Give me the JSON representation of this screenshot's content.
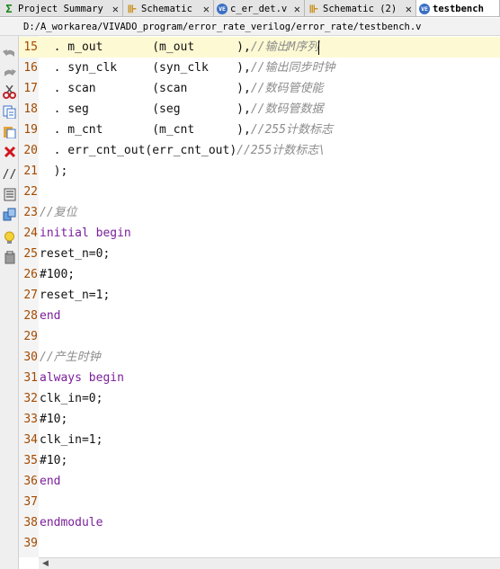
{
  "tabs": [
    {
      "label": "Project Summary",
      "icon": "sigma-icon",
      "active": false
    },
    {
      "label": "Schematic",
      "icon": "schematic-icon",
      "active": false
    },
    {
      "label": "c_er_det.v",
      "icon": "verilog-file-icon",
      "active": false
    },
    {
      "label": "Schematic (2)",
      "icon": "schematic-icon",
      "active": false
    },
    {
      "label": "testbench",
      "icon": "verilog-file-icon",
      "active": true
    }
  ],
  "tab_close_glyph": "✕",
  "file_path": "D:/A_workarea/VIVADO_program/error_rate_verilog/error_rate/testbench.v",
  "toolbar_icons": [
    "home-icon",
    "undo-icon",
    "redo-icon",
    "cut-icon",
    "copy-icon",
    "paste-icon",
    "delete-icon",
    "comment-icon",
    "grid-icon",
    "module-icon",
    "bulb-icon",
    "stamp-icon"
  ],
  "code_lines": [
    {
      "num": "15",
      "segs": [
        {
          "t": "  . m_out       (m_out      ),",
          "c": ""
        },
        {
          "t": "//输出M序列",
          "c": "cm"
        }
      ]
    },
    {
      "num": "16",
      "segs": [
        {
          "t": "  . syn_clk     (syn_clk    ),",
          "c": ""
        },
        {
          "t": "//输出同步时钟",
          "c": "cm"
        }
      ]
    },
    {
      "num": "17",
      "segs": [
        {
          "t": "  . scan        (scan       ),",
          "c": ""
        },
        {
          "t": "//数码管使能",
          "c": "cm"
        }
      ]
    },
    {
      "num": "18",
      "segs": [
        {
          "t": "  . seg         (seg        ),",
          "c": ""
        },
        {
          "t": "//数码管数据",
          "c": "cm"
        }
      ]
    },
    {
      "num": "19",
      "segs": [
        {
          "t": "  . m_cnt       (m_cnt      ),",
          "c": ""
        },
        {
          "t": "//255计数标志",
          "c": "cm"
        }
      ]
    },
    {
      "num": "20",
      "segs": [
        {
          "t": "  . err_cnt_out(err_cnt_out)",
          "c": ""
        },
        {
          "t": "//255计数标志\\",
          "c": "cm"
        }
      ]
    },
    {
      "num": "21",
      "segs": [
        {
          "t": "  );",
          "c": ""
        }
      ]
    },
    {
      "num": "22",
      "segs": []
    },
    {
      "num": "23",
      "segs": [
        {
          "t": "//复位",
          "c": "cm"
        }
      ]
    },
    {
      "num": "24",
      "segs": [
        {
          "t": "initial begin",
          "c": "kw"
        }
      ]
    },
    {
      "num": "25",
      "segs": [
        {
          "t": "reset_n=0;",
          "c": ""
        }
      ]
    },
    {
      "num": "26",
      "segs": [
        {
          "t": "#100;",
          "c": ""
        }
      ]
    },
    {
      "num": "27",
      "segs": [
        {
          "t": "reset_n=1;",
          "c": ""
        }
      ]
    },
    {
      "num": "28",
      "segs": [
        {
          "t": "end",
          "c": "kw"
        }
      ]
    },
    {
      "num": "29",
      "segs": []
    },
    {
      "num": "30",
      "segs": [
        {
          "t": "//产生时钟",
          "c": "cm"
        }
      ]
    },
    {
      "num": "31",
      "segs": [
        {
          "t": "always begin",
          "c": "kw"
        }
      ]
    },
    {
      "num": "32",
      "segs": [
        {
          "t": "clk_in=0;",
          "c": ""
        }
      ]
    },
    {
      "num": "33",
      "segs": [
        {
          "t": "#10;",
          "c": ""
        }
      ]
    },
    {
      "num": "34",
      "segs": [
        {
          "t": "clk_in=1;",
          "c": ""
        }
      ]
    },
    {
      "num": "35",
      "segs": [
        {
          "t": "#10;",
          "c": ""
        }
      ]
    },
    {
      "num": "36",
      "segs": [
        {
          "t": "end",
          "c": "kw"
        }
      ]
    },
    {
      "num": "37",
      "segs": []
    },
    {
      "num": "38",
      "segs": [
        {
          "t": "endmodule",
          "c": "kw"
        }
      ]
    },
    {
      "num": "39",
      "segs": []
    }
  ],
  "current_line": "15",
  "colors": {
    "keyword": "#7a1f9b",
    "comment": "#8c8c8c",
    "line_number": "#a34a00",
    "current_line_bg": "#fdf9d3"
  }
}
